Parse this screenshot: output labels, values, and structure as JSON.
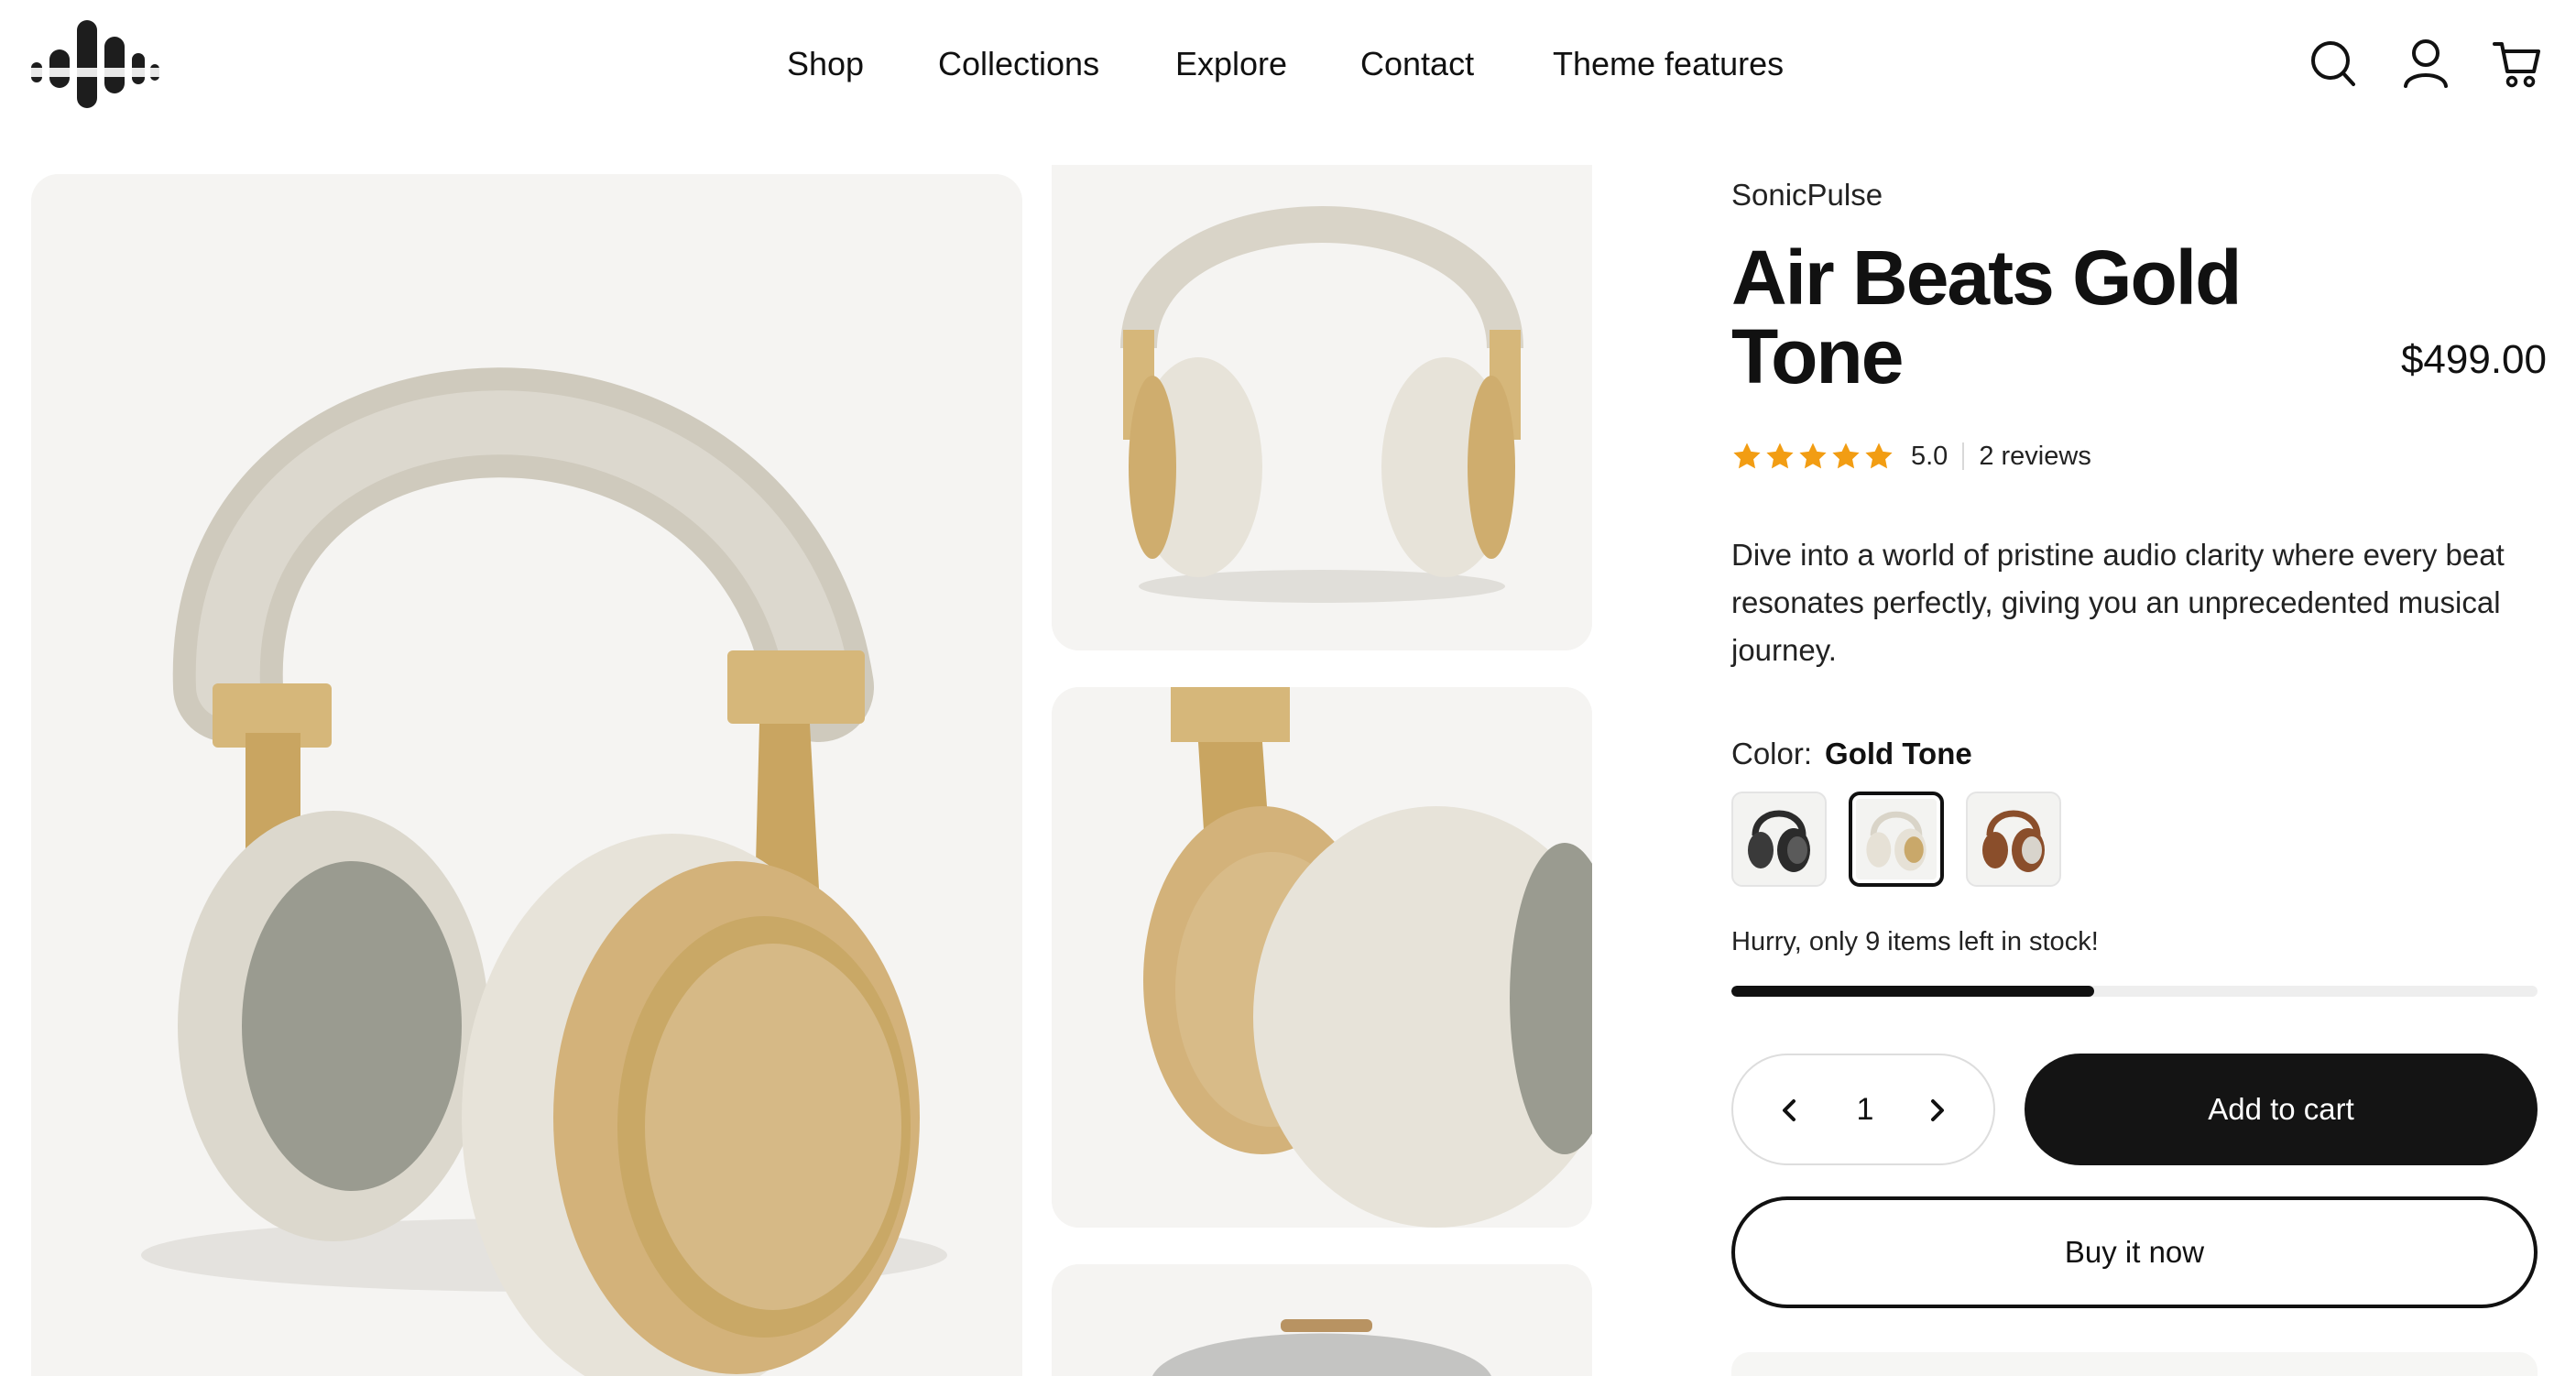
{
  "header": {
    "logo_icon": "brand-wave-logo",
    "nav": [
      {
        "label": "Shop"
      },
      {
        "label": "Collections"
      },
      {
        "label": "Explore"
      },
      {
        "label": "Contact"
      },
      {
        "label": "Theme features"
      }
    ],
    "icons": [
      "search-icon",
      "account-icon",
      "cart-icon"
    ]
  },
  "gallery": {
    "images": [
      "gold-tone-headphones-angle",
      "gold-tone-headphones-front",
      "gold-tone-headphones-closeup",
      "headphones-carry-case"
    ]
  },
  "product": {
    "vendor": "SonicPulse",
    "title": "Air Beats Gold Tone",
    "price": "$499.00",
    "rating": {
      "stars": 5,
      "value": "5.0",
      "reviews_label": "2 reviews"
    },
    "description": "Dive into a world of pristine audio clarity where every beat resonates perfectly, giving you an unprecedented musical journey.",
    "color": {
      "label": "Color:",
      "selected": "Gold Tone",
      "swatches": [
        {
          "name": "black-variant",
          "colors": [
            "#2b2b2b",
            "#5a5a5a"
          ]
        },
        {
          "name": "gold-tone-variant",
          "colors": [
            "#e6e1d6",
            "#c9a86a"
          ]
        },
        {
          "name": "brown-variant",
          "colors": [
            "#8a4e2b",
            "#d8d4cc"
          ]
        }
      ],
      "selected_index": 1
    },
    "stock": {
      "message": "Hurry, only 9 items left in stock!",
      "level": 0.45
    },
    "quantity": "1",
    "add_to_cart_label": "Add to cart",
    "buy_now_label": "Buy it now"
  },
  "colors": {
    "star": "#f29d13",
    "primary_button": "#141414",
    "stock_fill": "#111111",
    "availability_dot": "#2e9a3e"
  }
}
